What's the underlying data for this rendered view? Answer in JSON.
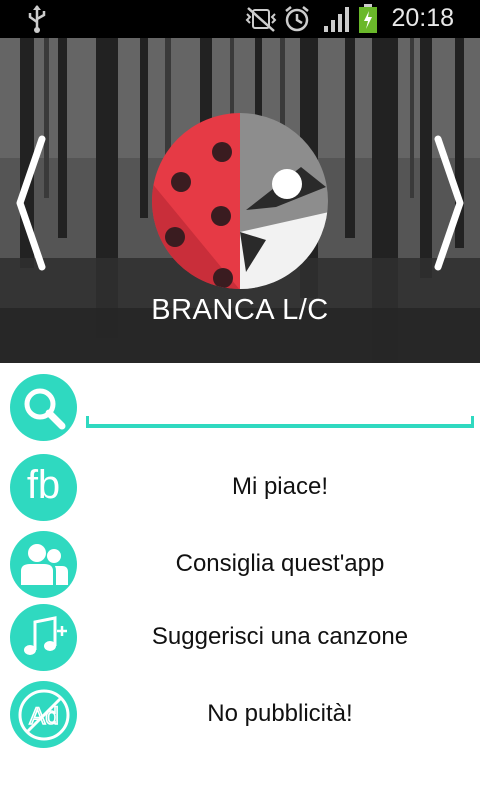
{
  "status_bar": {
    "time": "20:18",
    "icons": [
      "usb-icon",
      "mute-vibrate-icon",
      "alarm-icon",
      "signal-icon",
      "battery-charging-icon"
    ]
  },
  "hero": {
    "title": "BRANCA L/C",
    "nav": {
      "prev_icon": "chevron-left-icon",
      "next_icon": "chevron-right-icon"
    },
    "logo_icon": "ladybug-wolf-logo"
  },
  "search": {
    "value": "",
    "placeholder": "",
    "icon": "search-icon"
  },
  "menu": [
    {
      "icon": "facebook-icon",
      "icon_text": "fb",
      "label": "Mi piace!"
    },
    {
      "icon": "users-icon",
      "label": "Consiglia quest'app"
    },
    {
      "icon": "music-add-icon",
      "label": "Suggerisci una canzone"
    },
    {
      "icon": "no-ads-icon",
      "icon_text": "Ad",
      "label": "No pubblicità!"
    }
  ],
  "colors": {
    "accent": "#2fd9c0",
    "status_bar": "#000000",
    "ladybug_red": "#e63a45",
    "wolf_gray": "#8d8d8d"
  }
}
